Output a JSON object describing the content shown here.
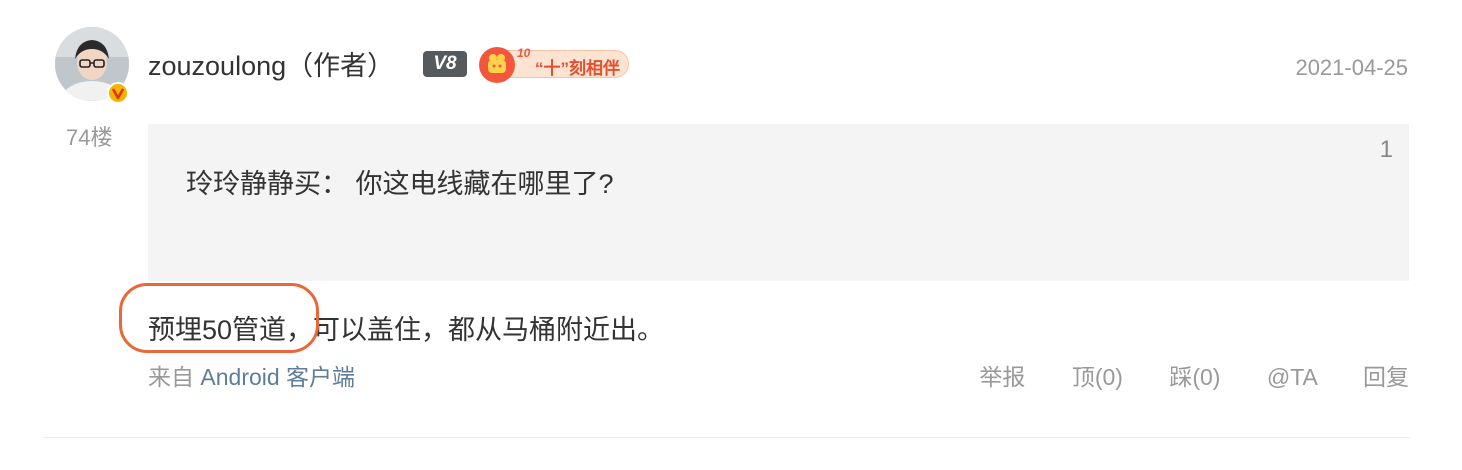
{
  "post": {
    "floor": "74楼",
    "author": {
      "name": "zouzoulong（作者）",
      "level": "V8",
      "medal_number": "10",
      "medal_text": "“十”刻相伴"
    },
    "date": "2021-04-25",
    "quote": {
      "text": "玲玲静静买： 你这电线藏在哪里了?",
      "count": "1"
    },
    "content": "预埋50管道，可以盖住，都从马桶附近出。",
    "source": {
      "prefix": "来自",
      "client": "Android 客户端"
    },
    "actions": {
      "report": "举报",
      "upvote": "顶(0)",
      "downvote": "踩(0)",
      "mention": "@TA",
      "reply": "回复"
    }
  },
  "colors": {
    "highlight": "#e8683b",
    "link": "#5f7d99",
    "muted": "#999999"
  }
}
